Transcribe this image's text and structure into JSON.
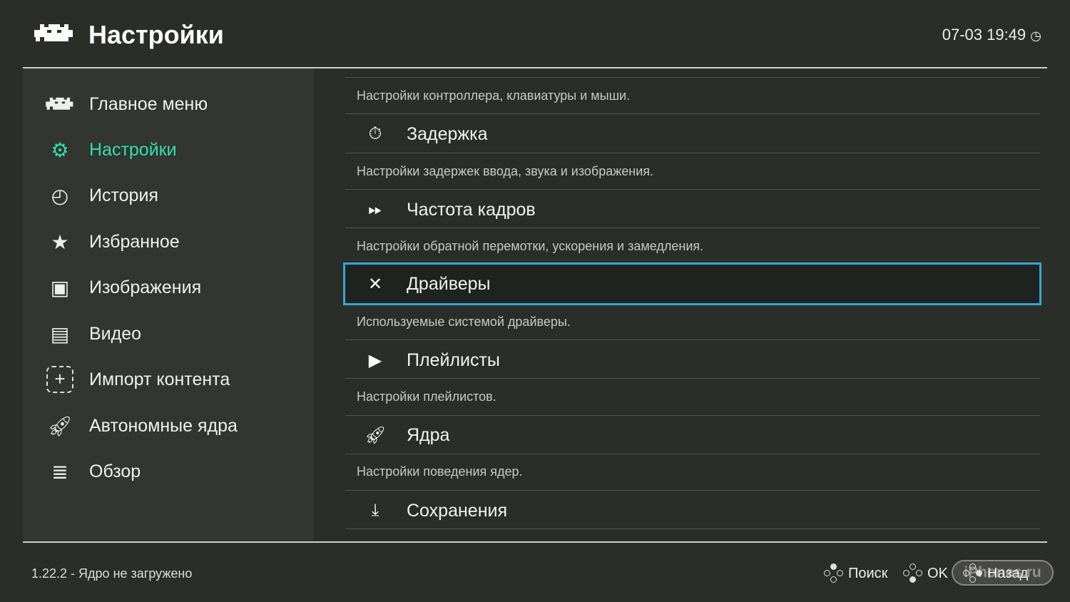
{
  "header": {
    "title": "Настройки",
    "clock": "07-03 19:49"
  },
  "sidebar": {
    "items": [
      {
        "label": "Главное меню",
        "icon": "invader-icon"
      },
      {
        "label": "Настройки",
        "icon": "gear-icon",
        "active": true
      },
      {
        "label": "История",
        "icon": "history-icon"
      },
      {
        "label": "Избранное",
        "icon": "star-icon"
      },
      {
        "label": "Изображения",
        "icon": "image-icon"
      },
      {
        "label": "Видео",
        "icon": "film-icon"
      },
      {
        "label": "Импорт контента",
        "icon": "plus-icon"
      },
      {
        "label": "Автономные ядра",
        "icon": "rocket-icon"
      },
      {
        "label": "Обзор",
        "icon": "database-icon"
      }
    ]
  },
  "content": {
    "top_sub": "Настройки контроллера, клавиатуры и мыши.",
    "items": [
      {
        "label": "Задержка",
        "sub": "Настройки задержек ввода, звука и изображения.",
        "icon": "stopwatch-icon"
      },
      {
        "label": "Частота кадров",
        "sub": "Настройки обратной перемотки, ускорения и замедления.",
        "icon": "fast-forward-icon"
      },
      {
        "label": "Драйверы",
        "sub": "Используемые системой драйверы.",
        "icon": "tools-icon",
        "selected": true
      },
      {
        "label": "Плейлисты",
        "sub": "Настройки плейлистов.",
        "icon": "file-play-icon"
      },
      {
        "label": "Ядра",
        "sub": "Настройки поведения ядер.",
        "icon": "rocket-icon"
      },
      {
        "label": "Сохранения",
        "icon": "download-icon"
      }
    ]
  },
  "footer": {
    "version": "1.22.2 - Ядро не загружено",
    "search": "Поиск",
    "ok": "OK",
    "back": "Назад",
    "watermark": "iPhones.ru"
  },
  "colors": {
    "accent": "#2fe0b0",
    "selection": "#33a7d6"
  }
}
